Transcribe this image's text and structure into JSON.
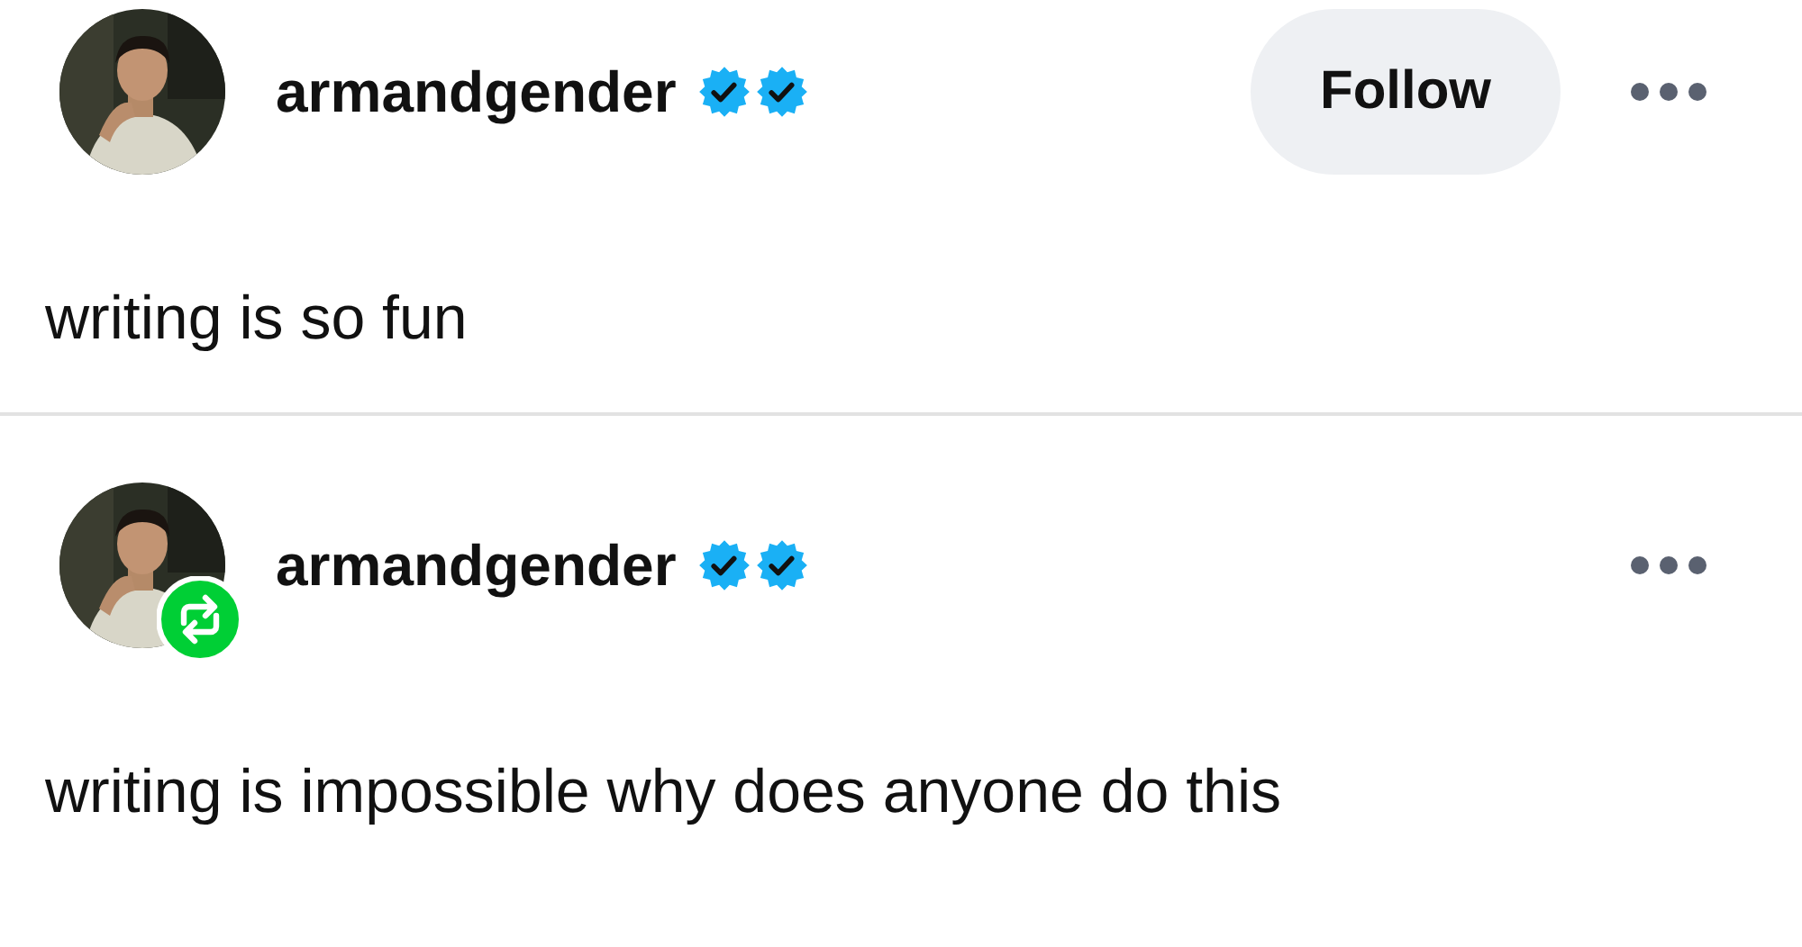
{
  "posts": [
    {
      "username": "armandgender",
      "reblogged": false,
      "badges": [
        {
          "kind": "verified"
        },
        {
          "kind": "verified"
        }
      ],
      "follow_button": "Follow",
      "body": "writing is so fun"
    },
    {
      "username": "armandgender",
      "reblogged": true,
      "badges": [
        {
          "kind": "verified"
        },
        {
          "kind": "verified"
        }
      ],
      "body": "writing is impossible why does anyone do this"
    }
  ]
}
